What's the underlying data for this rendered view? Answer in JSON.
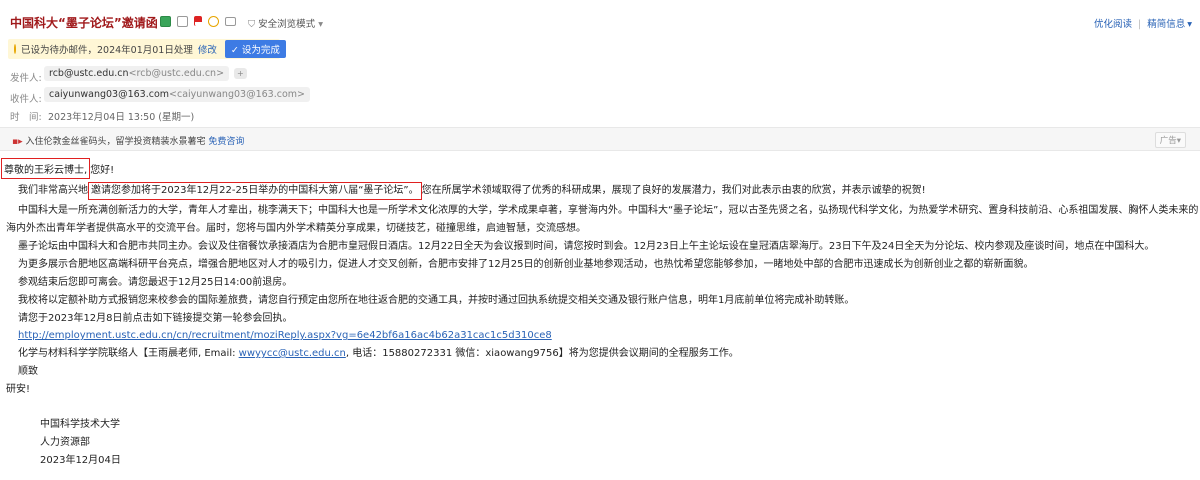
{
  "header": {
    "subject": "中国科大“墨子论坛”邀请函",
    "security_mode": "安全浏览模式",
    "links": {
      "optimize_read": "优化阅读",
      "brief_info": "精简信息"
    }
  },
  "pending": {
    "text": "已设为待办邮件，2024年01月01日处理",
    "modify": "修改",
    "done_button": "设为完成"
  },
  "meta": {
    "from_label": "发件人:",
    "from_name": "rcb@ustc.edu.cn",
    "from_addr": "<rcb@ustc.edu.cn>",
    "from_add": "+",
    "to_label": "收件人:",
    "to_name": "caiyunwang03@163.com",
    "to_addr": "<caiyunwang03@163.com>",
    "time_label": "时　间:",
    "time_value": "2023年12月04日 13:50 (星期一)"
  },
  "ad": {
    "text": "入住伦敦金丝雀码头，留学投资精装水景薯宅",
    "link": "免费咨询",
    "tag": "广告"
  },
  "body": {
    "greeting_name": "尊敬的王彩云博士,",
    "greeting_rest": "您好!",
    "p1_a": "我们非常高兴地",
    "p1_highlight": "邀请您参加将于2023年12月22-25日举办的中国科大第八届“墨子论坛”。",
    "p1_b": "您在所属学术领域取得了优秀的科研成果，展现了良好的发展潜力，我们对此表示由衷的欣赏，并表示诚挚的祝贺!",
    "p2_line1": "中国科大是一所充满创新活力的大学，青年人才辈出，桃李满天下；中国科大也是一所学术文化浓厚的大学，学术成果卓著，享誉海内外。中国科大“墨子论坛”，冠以古圣先贤之名，弘扬现代科学文化，为热爱学术研究、置身科技前沿、心系祖国发展、胸怀人类未来的",
    "p2_line2": "海内外杰出青年学者提供高水平的交流平台。届时，您将与国内外学术精英分享成果，切磋技艺，碰撞思维，启迪智慧，交流感想。",
    "p3": "墨子论坛由中国科大和合肥市共同主办。会议及住宿餐饮承接酒店为合肥市皇冠假日酒店。12月22日全天为会议报到时间，请您按时到会。12月23日上午主论坛设在皇冠酒店翠海厅。23日下午及24日全天为分论坛、校内参观及座谈时间，地点在中国科大。",
    "p4": "为更多展示合肥地区高端科研平台亮点，增强合肥地区对人才的吸引力，促进人才交叉创新，合肥市安排了12月25日的创新创业基地参观活动，也热忱希望您能够参加，一睹地处中部的合肥市迅速成长为创新创业之都的崭新面貌。",
    "p5": "参观结束后您即可离会。请您最迟于12月25日14:00前退房。",
    "p6": "我校将以定额补助方式报销您来校参会的国际差旅费，请您自行预定由您所在地往返合肥的交通工具，并按时通过回执系统提交相关交通及银行账户信息，明年1月底前单位将完成补助转账。",
    "p7": "请您于2023年12月8日前点击如下链接提交第一轮参会回执。",
    "url": "http://employment.ustc.edu.cn/cn/recruitment/moziReply.aspx?vg=6e42bf6a16ac4b62a31cac1c5d310ce8",
    "contact_a": "化学与材料科学学院联络人【王雨晨老师, Email: ",
    "contact_email": "wwyycc@ustc.edu.cn",
    "contact_b": ", 电话：15880272331 微信：xiaowang9756】将为您提供会议期间的全程服务工作。",
    "closing1": "顺致",
    "closing2": "研安!",
    "sig_org": "中国科学技术大学",
    "sig_dept": "人力资源部",
    "sig_date": "2023年12月04日"
  },
  "colors": {
    "subject": "#a0191b",
    "link": "#2a63b6",
    "button": "#3d7be4",
    "highlight_box": "#e02020"
  }
}
